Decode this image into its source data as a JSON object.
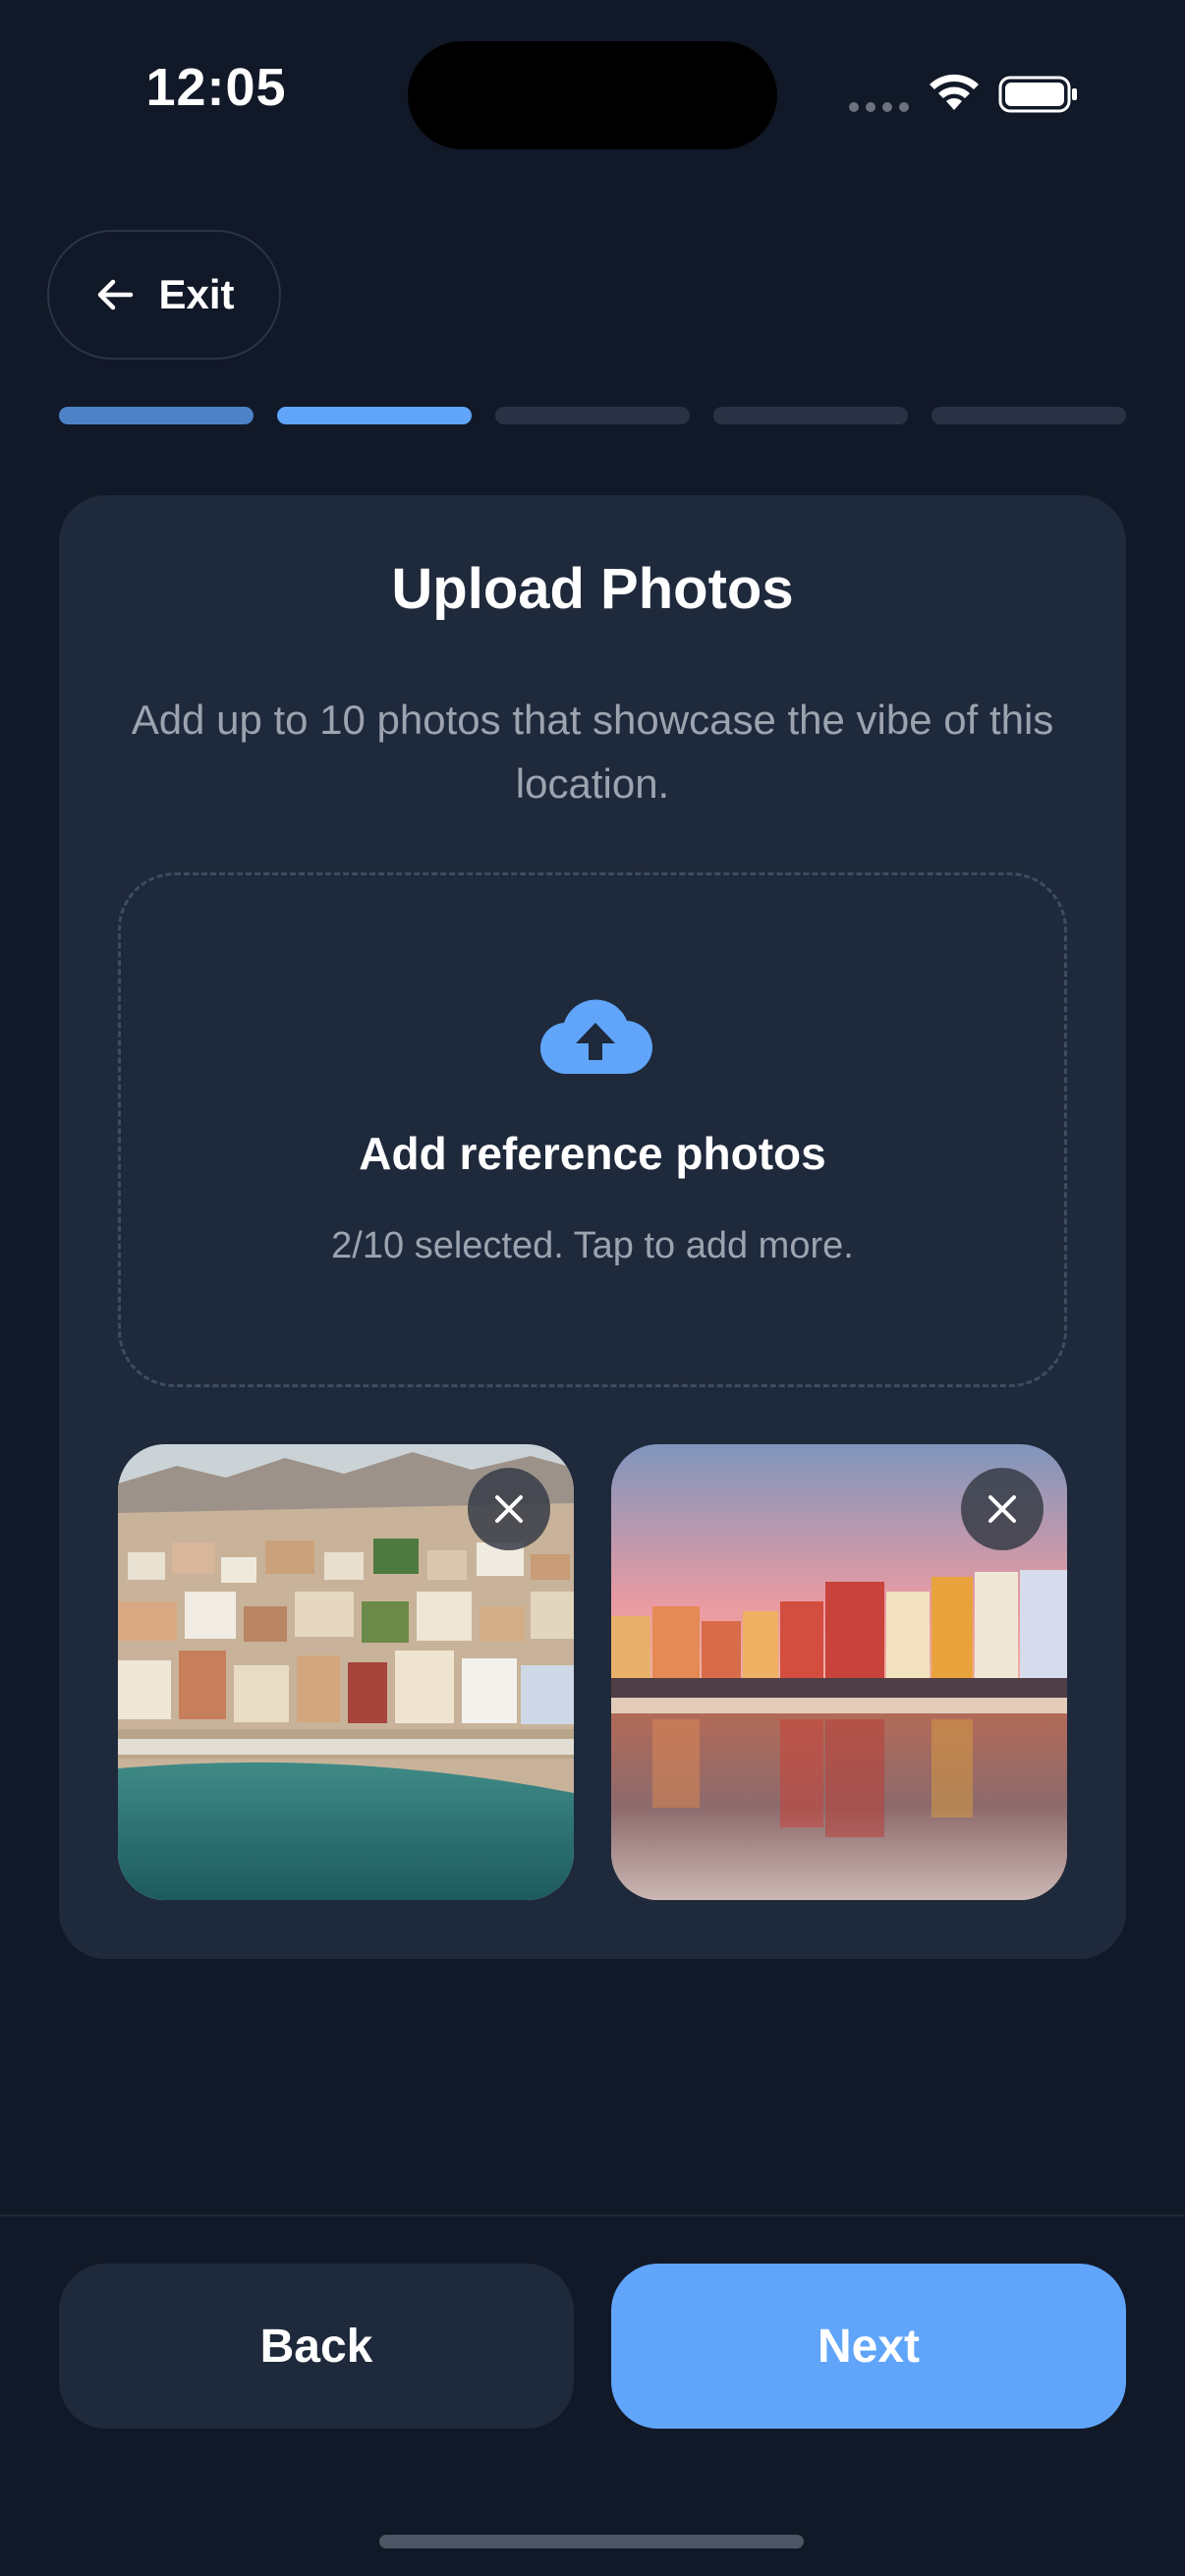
{
  "status_bar": {
    "time": "12:05",
    "icons": [
      "signal-dots-icon",
      "wifi-icon",
      "battery-icon"
    ]
  },
  "header": {
    "exit_label": "Exit",
    "exit_icon": "arrow-left-icon"
  },
  "progress": {
    "total_steps": 5,
    "current_step": 2
  },
  "card": {
    "title": "Upload Photos",
    "subtitle": "Add up to 10 photos that showcase the vibe of this location.",
    "dropzone": {
      "icon": "cloud-upload-icon",
      "title": "Add reference photos",
      "hint": "2/10 selected. Tap to add more."
    },
    "photos": [
      {
        "name": "coastal-town-aerial",
        "remove_icon": "close-icon"
      },
      {
        "name": "harbor-sunset",
        "remove_icon": "close-icon"
      }
    ]
  },
  "footer": {
    "back_label": "Back",
    "next_label": "Next"
  },
  "colors": {
    "background": "#111827",
    "card": "#1e293b",
    "accent": "#60a5fa",
    "muted_text": "#9ca3af"
  }
}
